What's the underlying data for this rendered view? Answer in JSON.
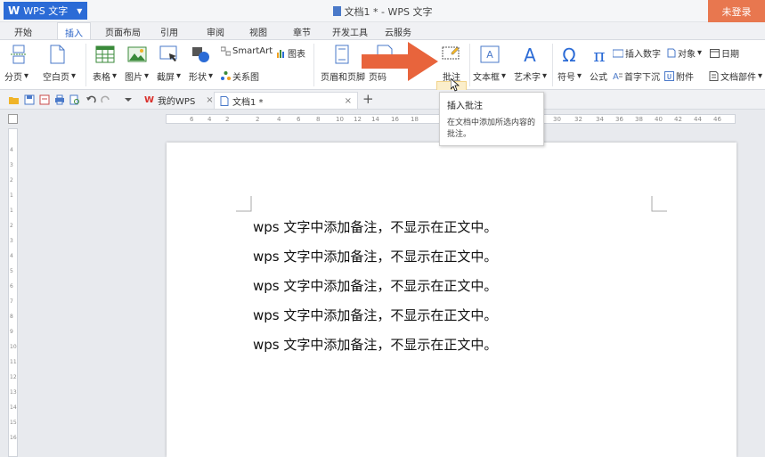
{
  "app": {
    "name": "WPS 文字",
    "title": "文档1 * - WPS 文字",
    "login": "未登录"
  },
  "tabs": [
    "开始",
    "插入",
    "页面布局",
    "引用",
    "审阅",
    "视图",
    "章节",
    "开发工具",
    "云服务"
  ],
  "active_tab": "插入",
  "ribbon": {
    "page_break": "分页",
    "blank_page": "空白页",
    "table": "表格",
    "picture": "图片",
    "screenshot": "截屏",
    "shapes": "形状",
    "smartart": "SmartArt",
    "chart": "图表",
    "relation": "关系图",
    "header_footer": "页眉和页脚",
    "page_number": "页码",
    "comment": "批注",
    "textbox": "文本框",
    "wordart": "艺术字",
    "symbol": "符号",
    "formula": "公式",
    "insert_number": "插入数字",
    "object": "对象",
    "date": "日期",
    "dropcap": "首字下沉",
    "attachment": "附件",
    "doc_parts": "文档部件"
  },
  "doc_tabs": {
    "my_wps": "我的WPS",
    "doc1": "文档1 *"
  },
  "tooltip": {
    "title": "插入批注",
    "desc": "在文档中添加所选内容的批注。"
  },
  "ruler_h": [
    "6",
    "4",
    "2",
    "2",
    "4",
    "6",
    "8",
    "10",
    "12",
    "14",
    "16",
    "18",
    "30",
    "32",
    "34",
    "36",
    "38",
    "40",
    "42",
    "44",
    "46"
  ],
  "ruler_v": [
    "4",
    "3",
    "2",
    "1",
    "1",
    "2",
    "3",
    "4",
    "5",
    "6",
    "7",
    "8",
    "9",
    "10",
    "11",
    "12",
    "13",
    "14",
    "15",
    "16"
  ],
  "doc": {
    "lines": [
      "wps 文字中添加备注，不显示在正文中。",
      "wps 文字中添加备注，不显示在正文中。",
      "wps 文字中添加备注，不显示在正文中。",
      "wps 文字中添加备注，不显示在正文中。",
      "wps 文字中添加备注，不显示在正文中。"
    ]
  },
  "colors": {
    "accent": "#2b6bd6",
    "login": "#e8774f",
    "arrow": "#e8643c"
  }
}
